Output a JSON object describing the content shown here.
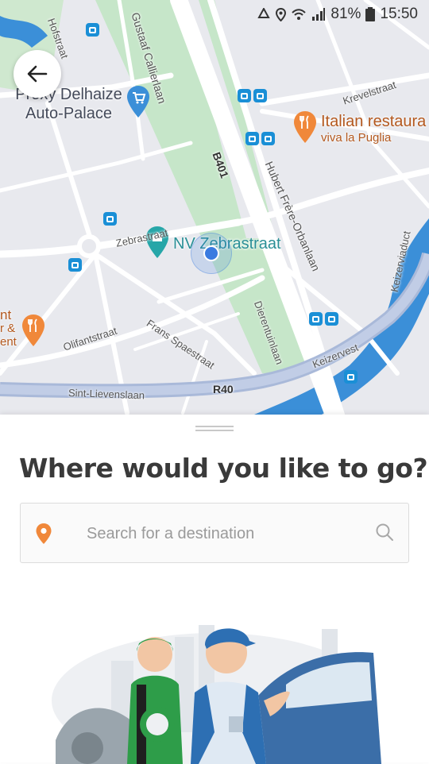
{
  "status_bar": {
    "battery": "81%",
    "time": "15:50"
  },
  "map": {
    "pois": {
      "proxy_delhaize_1": "Proxy Delhaize",
      "proxy_delhaize_2": "Auto-Palace",
      "italian_1": "Italian restaura",
      "italian_2": "viva la Puglia",
      "nv_zebrastraat": "NV Zebrastraat",
      "partial_1": "nt",
      "partial_2": "r &",
      "partial_3": "ent"
    },
    "streets": {
      "hofstraat": "Hofstraat",
      "gustaaf": "Gustaaf Callierlaan",
      "krevelstraat": "Krevelstraat",
      "hubert": "Hubert Frère-Orbanlaan",
      "keizerviaduct": "Keizerviaduct",
      "zebrastraat": "Zebrastraat",
      "olifantstraat": "Olifantstraat",
      "frans": "Frans Spaestraat",
      "dierentuin": "Dierentuinlaan",
      "keizervest": "Keizervest",
      "sint_lievens": "Sint-Lievenslaan",
      "r40": "R40",
      "b401": "B401"
    }
  },
  "sheet": {
    "headline": "Where would you like to go?",
    "search_placeholder": "Search for a destination"
  },
  "colors": {
    "water": "#3b8fd8",
    "park": "#c6e6c9",
    "accent_orange": "#f0883a",
    "location_dot": "#3a7be0",
    "transit_blue": "#1a8fd6"
  },
  "icons": {
    "back": "arrow-left-icon",
    "pin": "map-pin-icon",
    "search": "magnifier-icon"
  }
}
